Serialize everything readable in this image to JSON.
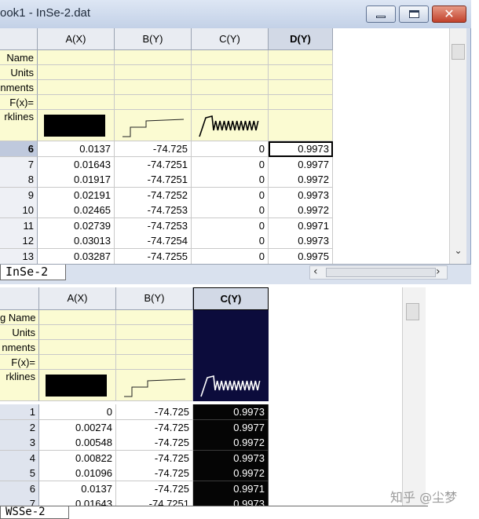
{
  "window1": {
    "title": "ook1 - InSe-2.dat",
    "columns": [
      "A(X)",
      "B(Y)",
      "C(Y)",
      "D(Y)"
    ],
    "meta_labels": [
      "Name",
      "Units",
      "nments",
      "F(x)=",
      "rklines"
    ],
    "rows": [
      {
        "n": "6",
        "a": "0.0137",
        "b": "-74.725",
        "c": "0",
        "d": "0.9973"
      },
      {
        "n": "7",
        "a": "0.01643",
        "b": "-74.7251",
        "c": "0",
        "d": "0.9977"
      },
      {
        "n": "8",
        "a": "0.01917",
        "b": "-74.7251",
        "c": "0",
        "d": "0.9972"
      },
      {
        "n": "9",
        "a": "0.02191",
        "b": "-74.7252",
        "c": "0",
        "d": "0.9973"
      },
      {
        "n": "10",
        "a": "0.02465",
        "b": "-74.7253",
        "c": "0",
        "d": "0.9972"
      },
      {
        "n": "11",
        "a": "0.02739",
        "b": "-74.7253",
        "c": "0",
        "d": "0.9971"
      },
      {
        "n": "12",
        "a": "0.03013",
        "b": "-74.7254",
        "c": "0",
        "d": "0.9973"
      },
      {
        "n": "13",
        "a": "0.03287",
        "b": "-74.7255",
        "c": "0",
        "d": "0.9975"
      }
    ],
    "sheet_tab": "InSe-2",
    "buttons": {
      "minimize": "minimize",
      "maximize": "maximize",
      "close": "close"
    }
  },
  "window2": {
    "columns": [
      "A(X)",
      "B(Y)",
      "C(Y)"
    ],
    "meta_labels": [
      "g Name",
      "Units",
      "nments",
      "F(x)=",
      "rklines"
    ],
    "rows": [
      {
        "n": "1",
        "a": "0",
        "b": "-74.725",
        "c": "0.9973"
      },
      {
        "n": "2",
        "a": "0.00274",
        "b": "-74.725",
        "c": "0.9977"
      },
      {
        "n": "3",
        "a": "0.00548",
        "b": "-74.725",
        "c": "0.9972"
      },
      {
        "n": "4",
        "a": "0.00822",
        "b": "-74.725",
        "c": "0.9973"
      },
      {
        "n": "5",
        "a": "0.01096",
        "b": "-74.725",
        "c": "0.9972"
      },
      {
        "n": "6",
        "a": "0.0137",
        "b": "-74.725",
        "c": "0.9971"
      },
      {
        "n": "7",
        "a": "0.01643",
        "b": "-74.7251",
        "c": "0.9973"
      }
    ],
    "sheet_tab": "WSSe-2"
  },
  "watermark": "知乎 @尘梦",
  "icons": {
    "scroll_up": "chevron-up-icon",
    "scroll_down": "chevron-down-icon",
    "scroll_left": "chevron-left-icon",
    "scroll_right": "chevron-right-icon"
  },
  "colors": {
    "meta_bg": "#fbfbd2",
    "selected_column_bg": "#0c0c3c",
    "titlebar": "#c3d1e7",
    "close_button": "#c1412b"
  }
}
